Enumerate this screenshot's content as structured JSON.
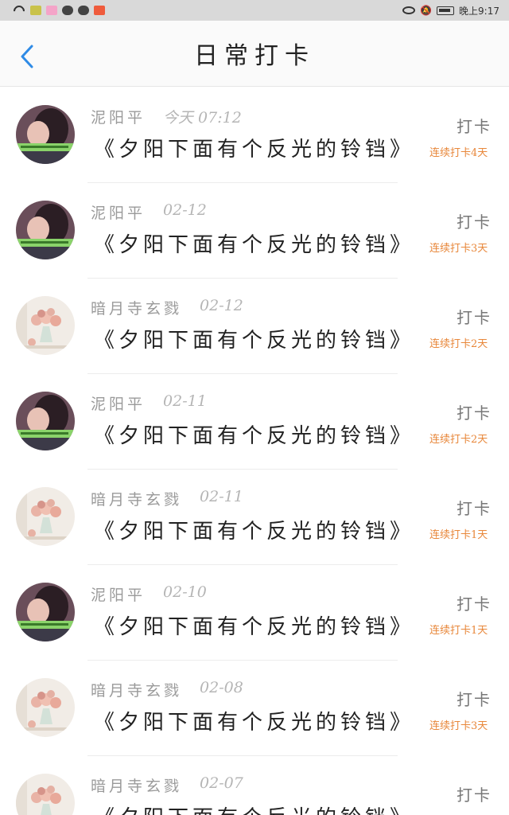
{
  "status_bar": {
    "time": "晚上9:17"
  },
  "header": {
    "title": "日常打卡"
  },
  "checkin_label": "打卡",
  "records": [
    {
      "name": "泥阳平",
      "time": "今天 07:12",
      "book": "《夕阳下面有个反光的铃铛》",
      "streak": "连续打卡4天",
      "avatar": "avatar-girl-icon"
    },
    {
      "name": "泥阳平",
      "time": "02-12",
      "book": "《夕阳下面有个反光的铃铛》",
      "streak": "连续打卡3天",
      "avatar": "avatar-girl-icon"
    },
    {
      "name": "暗月寺玄戮",
      "time": "02-12",
      "book": "《夕阳下面有个反光的铃铛》",
      "streak": "连续打卡2天",
      "avatar": "avatar-flowers-icon"
    },
    {
      "name": "泥阳平",
      "time": "02-11",
      "book": "《夕阳下面有个反光的铃铛》",
      "streak": "连续打卡2天",
      "avatar": "avatar-girl-icon"
    },
    {
      "name": "暗月寺玄戮",
      "time": "02-11",
      "book": "《夕阳下面有个反光的铃铛》",
      "streak": "连续打卡1天",
      "avatar": "avatar-flowers-icon"
    },
    {
      "name": "泥阳平",
      "time": "02-10",
      "book": "《夕阳下面有个反光的铃铛》",
      "streak": "连续打卡1天",
      "avatar": "avatar-girl-icon"
    },
    {
      "name": "暗月寺玄戮",
      "time": "02-08",
      "book": "《夕阳下面有个反光的铃铛》",
      "streak": "连续打卡3天",
      "avatar": "avatar-flowers-icon"
    },
    {
      "name": "暗月寺玄戮",
      "time": "02-07",
      "book": "《夕阳下面有个反光的铃铛》",
      "streak": "",
      "avatar": "avatar-flowers-icon"
    }
  ]
}
